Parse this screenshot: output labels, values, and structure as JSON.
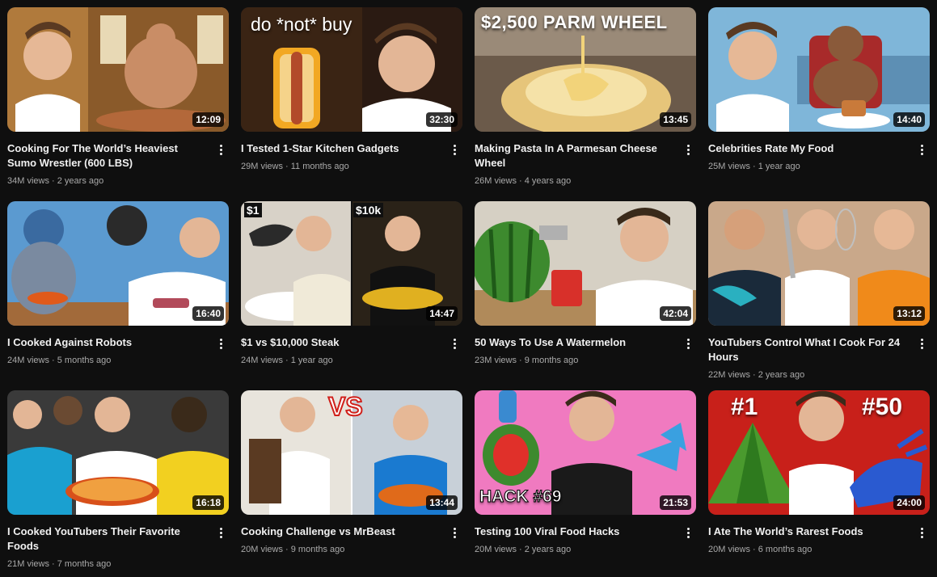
{
  "videos": [
    {
      "title": "Cooking For The World’s Heaviest Sumo Wrestler (600 LBS)",
      "views": "34M views",
      "age": "2 years ago",
      "duration": "12:09",
      "overlay": ""
    },
    {
      "title": "I Tested 1-Star Kitchen Gadgets",
      "views": "29M views",
      "age": "11 months ago",
      "duration": "32:30",
      "overlay": "do *not* buy"
    },
    {
      "title": "Making Pasta In A Parmesan Cheese Wheel",
      "views": "26M views",
      "age": "4 years ago",
      "duration": "13:45",
      "overlay": "$2,500 PARM WHEEL"
    },
    {
      "title": "Celebrities Rate My Food",
      "views": "25M views",
      "age": "1 year ago",
      "duration": "14:40",
      "overlay": ""
    },
    {
      "title": "I Cooked Against Robots",
      "views": "24M views",
      "age": "5 months ago",
      "duration": "16:40",
      "overlay": ""
    },
    {
      "title": "$1 vs $10,000 Steak",
      "views": "24M views",
      "age": "1 year ago",
      "duration": "14:47",
      "overlay": "$1",
      "overlay2": "$10k"
    },
    {
      "title": "50 Ways To Use A Watermelon",
      "views": "23M views",
      "age": "9 months ago",
      "duration": "42:04",
      "overlay": ""
    },
    {
      "title": "YouTubers Control What I Cook For 24 Hours",
      "views": "22M views",
      "age": "2 years ago",
      "duration": "13:12",
      "overlay": ""
    },
    {
      "title": "I Cooked YouTubers Their Favorite Foods",
      "views": "21M views",
      "age": "7 months ago",
      "duration": "16:18",
      "overlay": ""
    },
    {
      "title": "Cooking Challenge vs MrBeast",
      "views": "20M views",
      "age": "9 months ago",
      "duration": "13:44",
      "overlay": "VS"
    },
    {
      "title": "Testing 100 Viral Food Hacks",
      "views": "20M views",
      "age": "2 years ago",
      "duration": "21:53",
      "overlay": "HACK #69"
    },
    {
      "title": "I Ate The World’s Rarest Foods",
      "views": "20M views",
      "age": "6 months ago",
      "duration": "24:00",
      "overlay": "#1",
      "overlay2": "#50"
    }
  ],
  "icons": {
    "menu": "more-vert-icon"
  }
}
